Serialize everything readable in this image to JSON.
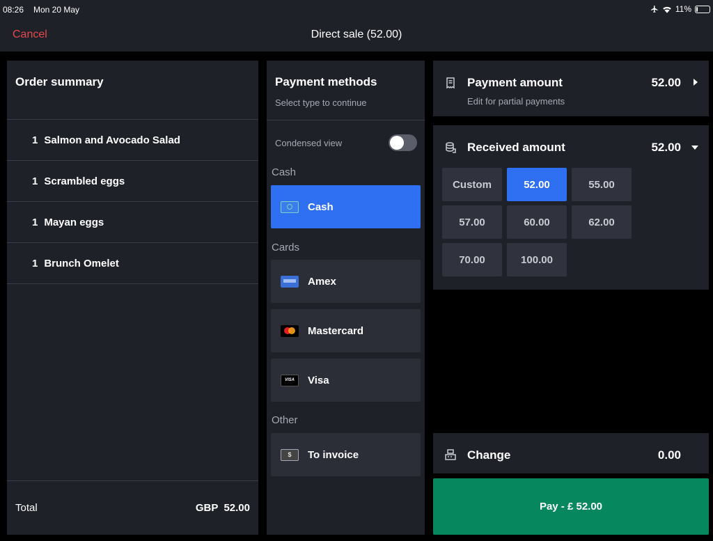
{
  "status_bar": {
    "time": "08:26",
    "date": "Mon 20 May",
    "battery": "11%"
  },
  "navbar": {
    "cancel_label": "Cancel",
    "title": "Direct sale (52.00)"
  },
  "order_summary": {
    "title": "Order summary",
    "items": [
      {
        "qty": "1",
        "name": "Salmon and Avocado Salad"
      },
      {
        "qty": "1",
        "name": "Scrambled eggs"
      },
      {
        "qty": "1",
        "name": "Mayan eggs"
      },
      {
        "qty": "1",
        "name": "Brunch Omelet"
      }
    ],
    "total_label": "Total",
    "total_value": "GBP  52.00"
  },
  "payment_methods": {
    "title": "Payment methods",
    "subtitle": "Select type to continue",
    "condensed_label": "Condensed view",
    "condensed_on": false,
    "sections": {
      "cash": "Cash",
      "cards": "Cards",
      "other": "Other"
    },
    "methods": {
      "cash": "Cash",
      "amex": "Amex",
      "mastercard": "Mastercard",
      "visa": "Visa",
      "invoice": "To invoice"
    },
    "selected": "cash"
  },
  "payment_amount": {
    "title": "Payment amount",
    "hint": "Edit for partial payments",
    "value": "52.00"
  },
  "received_amount": {
    "title": "Received amount",
    "value": "52.00",
    "options": [
      "Custom",
      "52.00",
      "55.00",
      "57.00",
      "60.00",
      "62.00",
      "70.00",
      "100.00"
    ],
    "selected": "52.00"
  },
  "change": {
    "title": "Change",
    "value": "0.00"
  },
  "pay_button": {
    "label": "Pay - £ 52.00"
  },
  "colors": {
    "accent": "#2f6ff2",
    "pay": "#07875e",
    "cancel": "#e5484d"
  }
}
